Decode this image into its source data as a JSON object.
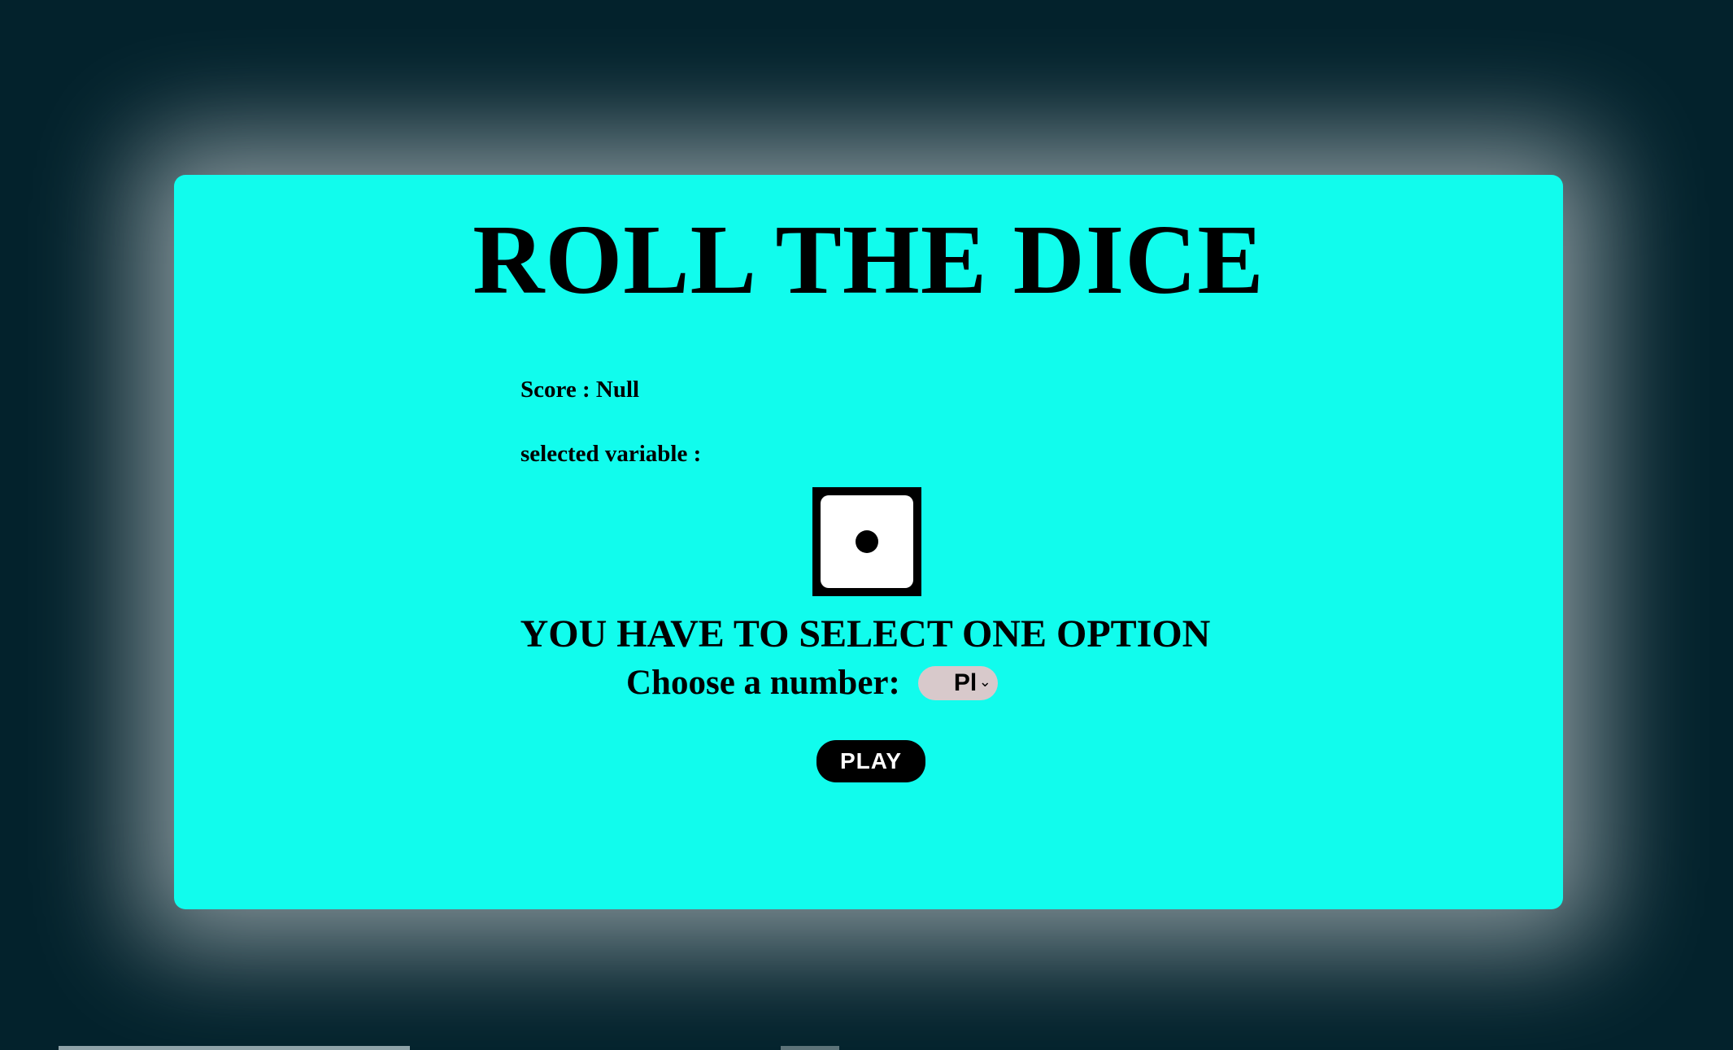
{
  "game": {
    "title": "ROLL THE DICE",
    "score_label": "Score : Null",
    "selected_label": "selected variable :",
    "die_value": 1,
    "warning": "YOU HAVE TO SELECT ONE OPTION",
    "choose_label": "Choose a number:",
    "select_value": "Pl",
    "play_label": "PLAY"
  },
  "colors": {
    "background": "#03222c",
    "card": "#11fced",
    "select": "#d8c9cb",
    "button": "#000000"
  },
  "icons": {
    "die": "die-face-one-icon",
    "chevron": "chevron-down-icon"
  }
}
